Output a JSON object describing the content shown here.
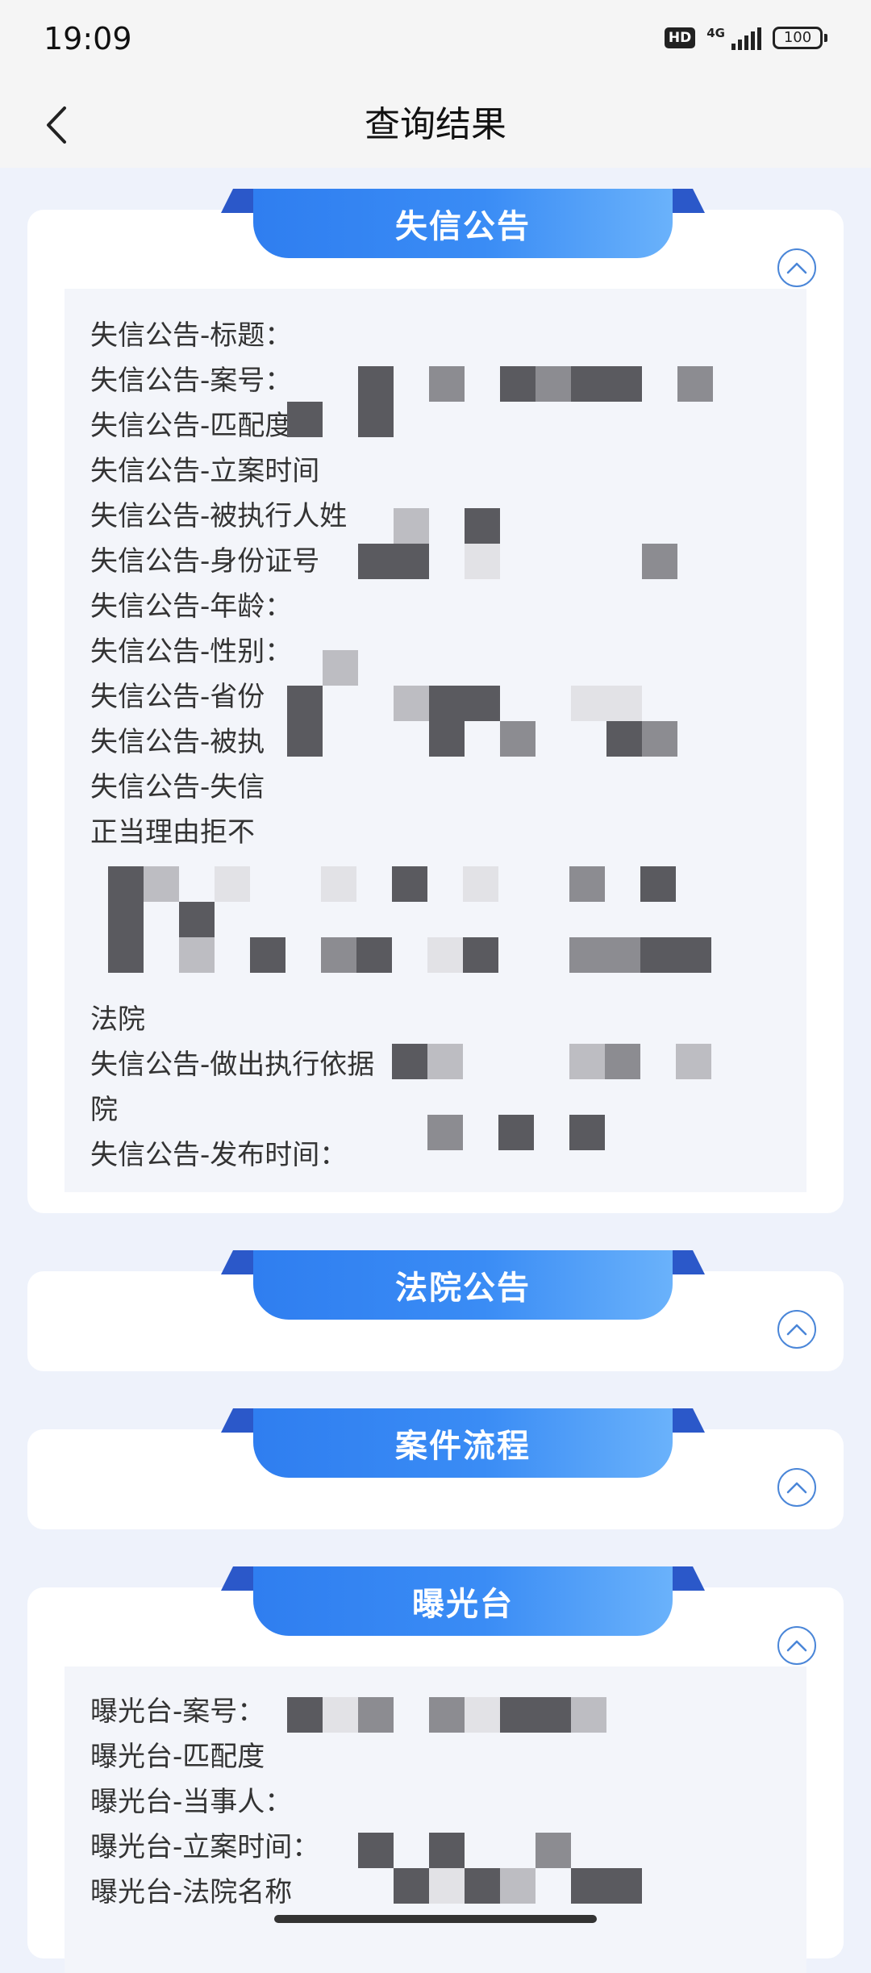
{
  "status_bar": {
    "time": "19:09",
    "hd": "HD",
    "network": "4G",
    "battery": "100"
  },
  "nav": {
    "title": "查询结果"
  },
  "sections": [
    {
      "title": "失信公告",
      "lines": [
        "失信公告-标题：",
        "失信公告-案号：",
        "失信公告-匹配度",
        "失信公告-立案时间",
        "失信公告-被执行人姓",
        "失信公告-身份证号",
        "失信公告-年龄：",
        "失信公告-性别：",
        "失信公告-省份",
        "失信公告-被执",
        "失信公告-失信",
        "正当理由拒不",
        "",
        "",
        "法院",
        "失信公告-做出执行依据",
        "院",
        "失信公告-发布时间："
      ]
    },
    {
      "title": "法院公告"
    },
    {
      "title": "案件流程"
    },
    {
      "title": "曝光台",
      "lines": [
        "曝光台-案号：",
        "曝光台-匹配度",
        "曝光台-当事人：",
        "曝光台-立案时间：",
        "曝光台-法院名称"
      ]
    }
  ]
}
